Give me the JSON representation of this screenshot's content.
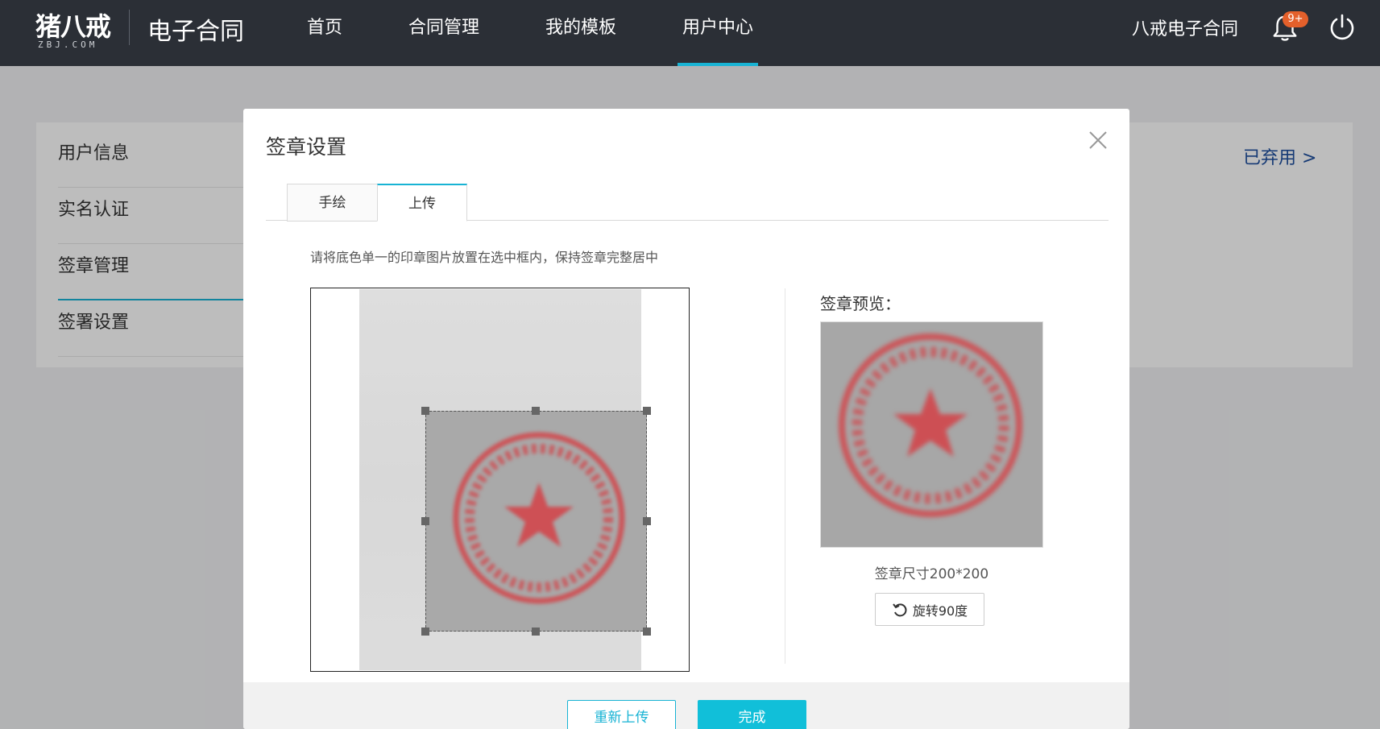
{
  "header": {
    "logo_text": "猪八戒",
    "logo_sub": "ZBJ.COM",
    "app_title": "电子合同",
    "nav": [
      {
        "label": "首页",
        "active": false
      },
      {
        "label": "合同管理",
        "active": false
      },
      {
        "label": "我的模板",
        "active": false
      },
      {
        "label": "用户中心",
        "active": true
      }
    ],
    "user_name": "八戒电子合同",
    "notification_badge": "9+",
    "icons": {
      "bell": "bell-icon",
      "power": "power-icon"
    }
  },
  "sidebar": {
    "items": [
      {
        "label": "用户信息"
      },
      {
        "label": "实名认证"
      },
      {
        "label": "签章管理",
        "active": true
      },
      {
        "label": "签署设置"
      }
    ]
  },
  "main": {
    "enabled_link": "已弃用  >"
  },
  "modal": {
    "title": "签章设置",
    "tabs": [
      {
        "label": "手绘",
        "active": false
      },
      {
        "label": "上传",
        "active": true
      }
    ],
    "instruction": "请将底色单一的印章图片放置在选中框内，保持签章完整居中",
    "preview_label": "签章预览：",
    "size_text": "签章尺寸200*200",
    "rotate_label": "旋转90度",
    "reupload_label": "重新上传",
    "done_label": "完成"
  },
  "colors": {
    "header_bg": "#2b2f36",
    "accent": "#18b3d4",
    "seal_red": "#d2464b"
  }
}
